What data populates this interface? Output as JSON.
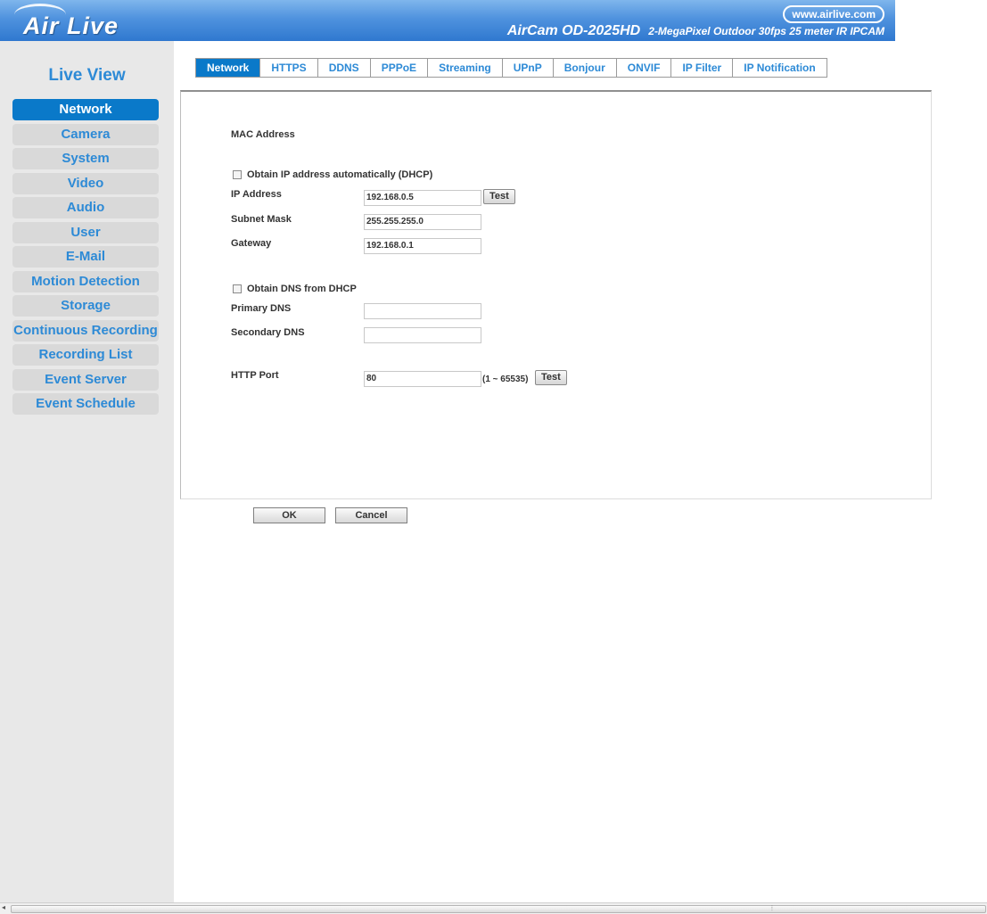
{
  "header": {
    "logo_text": "Air Live",
    "url": "www.airlive.com",
    "model": "AirCam OD-2025HD",
    "model_desc": "2-MegaPixel Outdoor 30fps 25 meter IR IPCAM"
  },
  "sidebar": {
    "title": "Live View",
    "items": [
      {
        "label": "Network"
      },
      {
        "label": "Camera"
      },
      {
        "label": "System"
      },
      {
        "label": "Video"
      },
      {
        "label": "Audio"
      },
      {
        "label": "User"
      },
      {
        "label": "E-Mail"
      },
      {
        "label": "Motion Detection"
      },
      {
        "label": "Storage"
      },
      {
        "label": "Continuous Recording"
      },
      {
        "label": "Recording List"
      },
      {
        "label": "Event Server"
      },
      {
        "label": "Event Schedule"
      }
    ]
  },
  "tabs": [
    {
      "label": "Network"
    },
    {
      "label": "HTTPS"
    },
    {
      "label": "DDNS"
    },
    {
      "label": "PPPoE"
    },
    {
      "label": "Streaming"
    },
    {
      "label": "UPnP"
    },
    {
      "label": "Bonjour"
    },
    {
      "label": "ONVIF"
    },
    {
      "label": "IP Filter"
    },
    {
      "label": "IP Notification"
    }
  ],
  "form": {
    "mac_label": "MAC Address",
    "dhcp_label": "Obtain IP address automatically (DHCP)",
    "ip_label": "IP Address",
    "ip_value": "192.168.0.5",
    "test_label": "Test",
    "subnet_label": "Subnet Mask",
    "subnet_value": "255.255.255.0",
    "gateway_label": "Gateway",
    "gateway_value": "192.168.0.1",
    "dns_dhcp_label": "Obtain DNS from DHCP",
    "primary_dns_label": "Primary DNS",
    "primary_dns_value": "",
    "secondary_dns_label": "Secondary DNS",
    "secondary_dns_value": "",
    "http_port_label": "HTTP Port",
    "http_port_value": "80",
    "http_port_range": "(1 ~ 65535)"
  },
  "actions": {
    "ok": "OK",
    "cancel": "Cancel"
  },
  "colors": {
    "accent": "#0a79c9",
    "menu_text": "#2d8ad6",
    "sidebar_bg": "#e8e8e8"
  }
}
